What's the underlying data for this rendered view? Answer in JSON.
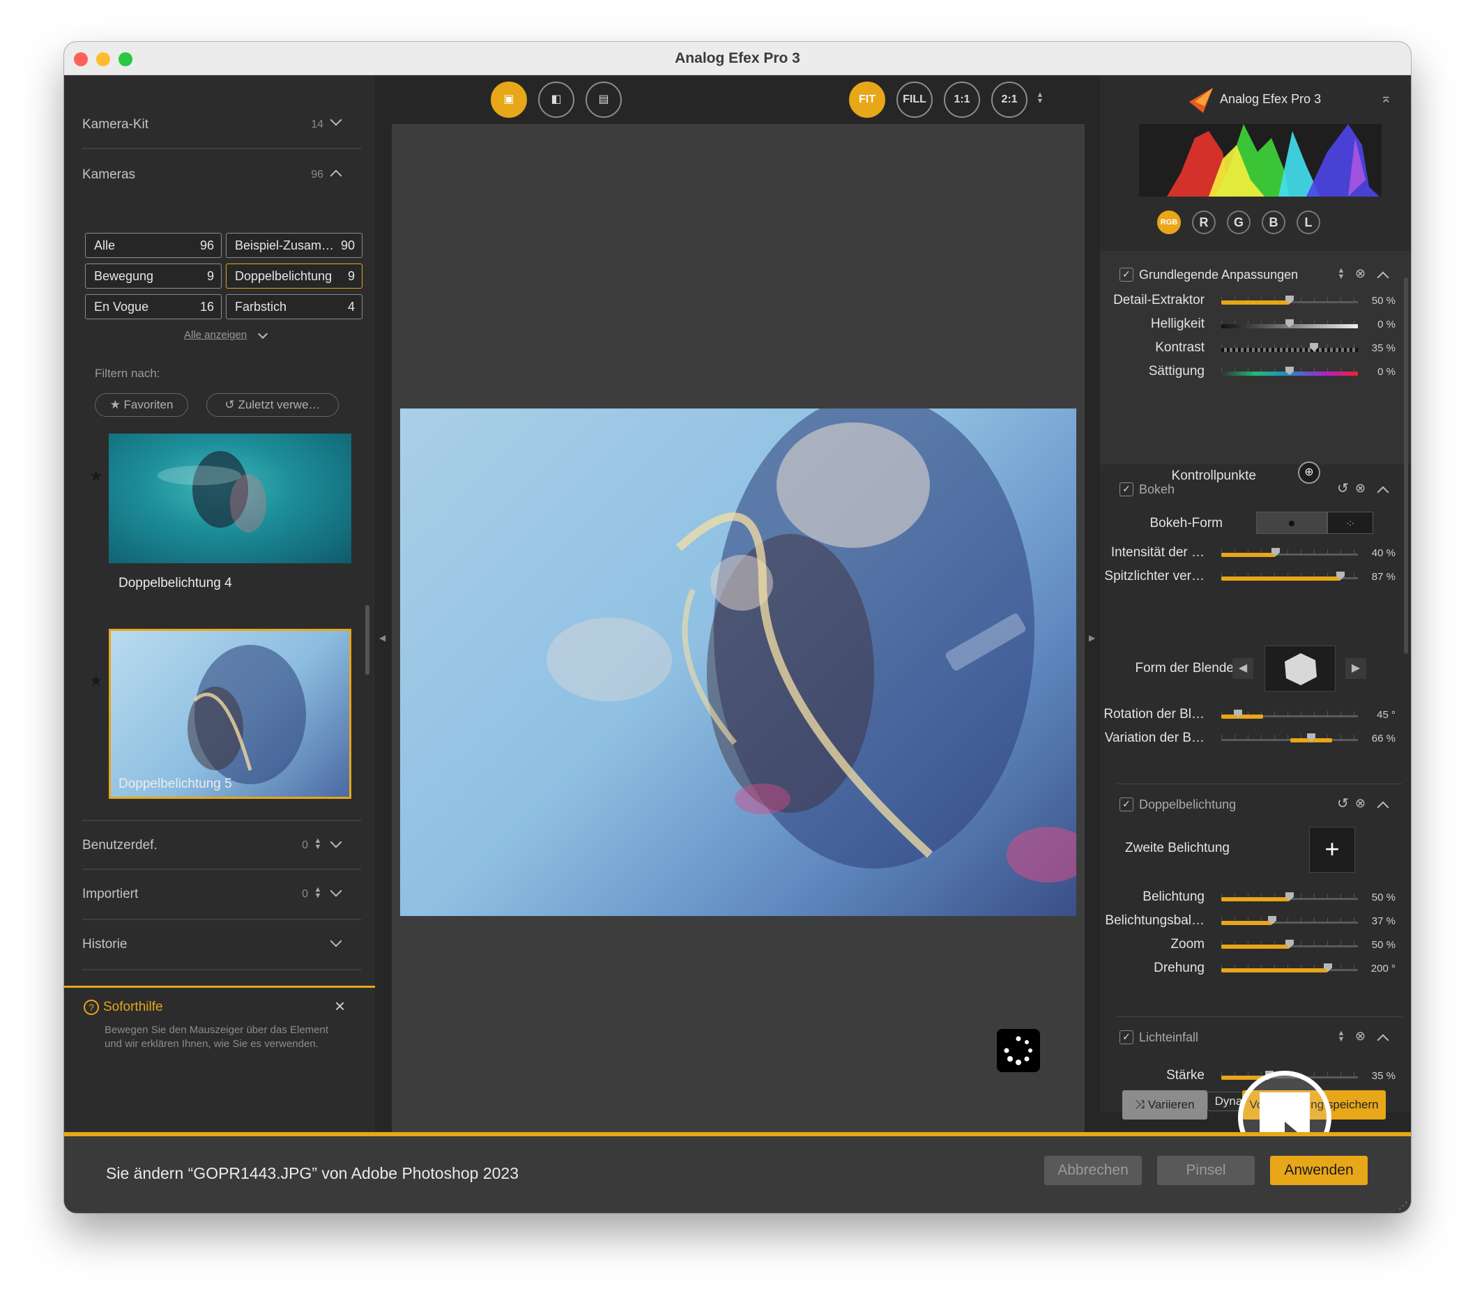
{
  "window": {
    "title": "Analog Efex Pro 3"
  },
  "left": {
    "kamera_kit": {
      "label": "Kamera-Kit",
      "count": "14"
    },
    "kameras": {
      "label": "Kameras",
      "count": "96"
    },
    "chips": [
      {
        "label": "Alle",
        "count": "96"
      },
      {
        "label": "Beispiel-Zusam…",
        "count": "90"
      },
      {
        "label": "Bewegung",
        "count": "9"
      },
      {
        "label": "Doppelbelichtung",
        "count": "9"
      },
      {
        "label": "En Vogue",
        "count": "16"
      },
      {
        "label": "Farbstich",
        "count": "4"
      }
    ],
    "show_all": "Alle anzeigen",
    "filter_label": "Filtern nach:",
    "filter_favorites": "Favoriten",
    "filter_recent": "Zuletzt verwe…",
    "presets": [
      {
        "caption": "Doppelbelichtung 4"
      },
      {
        "caption": "Doppelbelichtung 5"
      }
    ],
    "benutzerdef": {
      "label": "Benutzerdef.",
      "count": "0"
    },
    "importiert": {
      "label": "Importiert",
      "count": "0"
    },
    "historie": {
      "label": "Historie"
    },
    "help": {
      "title": "Soforthilfe",
      "text1": "Bewegen Sie den Mauszeiger über das Element",
      "text2": "und wir erklären Ihnen, wie Sie es verwenden."
    }
  },
  "toolbar": {
    "fit": "FIT",
    "fill": "FILL",
    "one": "1:1",
    "two": "2:1"
  },
  "right": {
    "brand": "Analog Efex Pro 3",
    "histogram_channels": [
      "RGB",
      "R",
      "G",
      "B",
      "L"
    ],
    "basic": {
      "title": "Grundlegende Anpassungen",
      "sliders": [
        {
          "label": "Detail-Extraktor",
          "value": "50 %",
          "pos": 0.5
        },
        {
          "label": "Helligkeit",
          "value": "0 %",
          "pos": 0.5
        },
        {
          "label": "Kontrast",
          "value": "35 %",
          "pos": 0.68
        },
        {
          "label": "Sättigung",
          "value": "0 %",
          "pos": 0.5
        }
      ],
      "control_points": "Kontrollpunkte"
    },
    "bokeh": {
      "title": "Bokeh",
      "shape_label": "Bokeh-Form",
      "sliders": [
        {
          "label": "Intensität der …",
          "value": "40 %",
          "pos": 0.4
        },
        {
          "label": "Spitzlichter ver…",
          "value": "87 %",
          "pos": 0.87
        }
      ],
      "aperture_label": "Form der Blende",
      "sliders2": [
        {
          "label": "Rotation der Bl…",
          "value": "45 °",
          "pos": 0.12
        },
        {
          "label": "Variation der B…",
          "value": "66 %",
          "pos": 0.66
        }
      ]
    },
    "double": {
      "title": "Doppelbelichtung",
      "second_label": "Zweite Belichtung",
      "sliders": [
        {
          "label": "Belichtung",
          "value": "50 %",
          "pos": 0.5
        },
        {
          "label": "Belichtungsbal…",
          "value": "37 %",
          "pos": 0.37
        },
        {
          "label": "Zoom",
          "value": "50 %",
          "pos": 0.5
        },
        {
          "label": "Drehung",
          "value": "200 °",
          "pos": 0.78
        }
      ]
    },
    "light": {
      "title": "Lichteinfall",
      "sliders": [
        {
          "label": "Stärke",
          "value": "35 %",
          "pos": 0.35
        }
      ],
      "mode": "Dynamisch"
    },
    "vary_button": "Variieren",
    "save_button": "Voreinstellung speichern"
  },
  "bottom": {
    "status": "Sie ändern “GOPR1443.JPG” von Adobe Photoshop 2023",
    "cancel": "Abbrechen",
    "brush": "Pinsel",
    "apply": "Anwenden"
  },
  "colors": {
    "accent": "#e8a619",
    "panel": "#2c2c2c",
    "canvas": "#3d3d3d"
  }
}
